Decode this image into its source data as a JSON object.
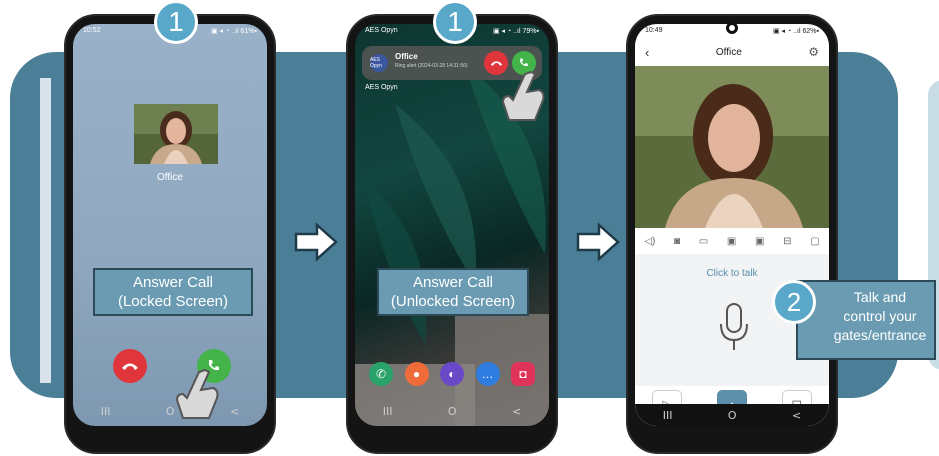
{
  "steps": {
    "step1a": "1",
    "step1b": "1",
    "step2": "2"
  },
  "phone1": {
    "status_time": "10:52",
    "status_icons": "▣ ◂ ◔ ..ıl 61%▪",
    "caller_name": "Office",
    "label": {
      "line1": "Answer Call",
      "line2": "(Locked Screen)"
    },
    "nav": {
      "recent": "III",
      "home": "O",
      "back": "<"
    }
  },
  "phone2": {
    "status_app": "AES Opyn",
    "status_icons": "▣ ◂ ◔ ..ıl 79%▪",
    "notification": {
      "avatar": "AES Opyn",
      "title": "Office",
      "subtitle": "Ring alert (2024-03-28 14:31:56)"
    },
    "home_label": "AES Opyn",
    "label": {
      "line1": "Answer Call",
      "line2": "(Unlocked Screen)"
    },
    "nav": {
      "recent": "III",
      "home": "O",
      "back": "<"
    }
  },
  "phone3": {
    "status_time": "10:49",
    "status_icons": "▣ ◂ ◔ ..ıl 62%▪",
    "title": "Office",
    "click_to_talk": "Click to talk",
    "nav": {
      "recent": "III",
      "home": "O",
      "back": "<"
    }
  },
  "callout": {
    "line1": "Talk and",
    "line2": "control your",
    "line3": "gates/entrance"
  },
  "colors": {
    "banner": "#4b7f97",
    "step_circle": "#5aa8c9",
    "label_fill": "#6a9bb2",
    "decline": "#e0363b",
    "accept": "#43b34a"
  },
  "icons": [
    "arrow-right-icon",
    "decline-call-icon",
    "accept-call-icon",
    "pointing-hand-icon",
    "microphone-icon",
    "settings-gear-icon",
    "back-chevron-icon",
    "speaker-icon",
    "camera-icon",
    "video-icon",
    "play-icon",
    "lock-icon"
  ]
}
